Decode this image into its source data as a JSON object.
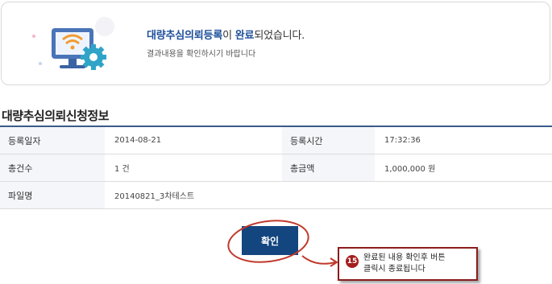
{
  "complete": {
    "message_highlight_1": "대량추심의뢰등록",
    "message_mid": "이 ",
    "message_highlight_2": "완료",
    "message_tail": "되었습니다.",
    "sub_message": "결과내용을 확인하시기 바랍니다"
  },
  "section": {
    "title": "대량추심의뢰신청정보"
  },
  "info": {
    "reg_date_label": "등록일자",
    "reg_date_value": "2014-08-21",
    "reg_time_label": "등록시간",
    "reg_time_value": "17:32:36",
    "total_count_label": "총건수",
    "total_count_value": "1 건",
    "total_amount_label": "총금액",
    "total_amount_value": "1,000,000 원",
    "file_name_label": "파일명",
    "file_name_value": "20140821_3차테스트"
  },
  "buttons": {
    "confirm_label": "확인"
  },
  "callout": {
    "number": "15",
    "text": "완료된 내용 확인후 버튼\n클릭시 종료됩니다"
  },
  "colors": {
    "accent": "#1d4e9b",
    "button": "#13457f",
    "annotation": "#c0392b"
  },
  "icons": {
    "illustration": "monitor-wifi-gear-icon"
  }
}
